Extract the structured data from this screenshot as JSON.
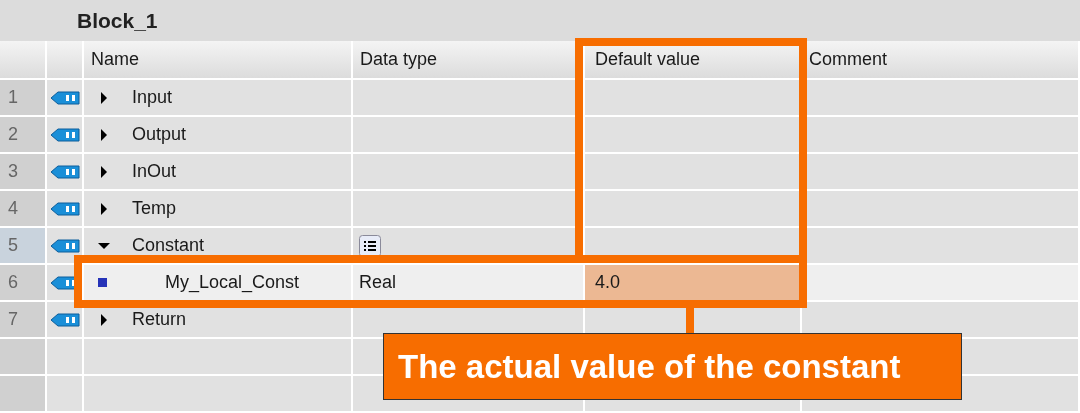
{
  "title": "Block_1",
  "columns": [
    "Name",
    "Data type",
    "Default value",
    "Comment"
  ],
  "rows": [
    {
      "number": "1",
      "kind": "section",
      "name": "Input",
      "expanded": false,
      "selected": false
    },
    {
      "number": "2",
      "kind": "section",
      "name": "Output",
      "expanded": false,
      "selected": false
    },
    {
      "number": "3",
      "kind": "section",
      "name": "InOut",
      "expanded": false,
      "selected": false
    },
    {
      "number": "4",
      "kind": "section",
      "name": "Temp",
      "expanded": false,
      "selected": false
    },
    {
      "number": "5",
      "kind": "section",
      "name": "Constant",
      "expanded": true,
      "selected": true
    },
    {
      "number": "6",
      "kind": "member",
      "name": "My_Local_Const",
      "data_type": "Real",
      "default_value": "4.0",
      "selected": false
    },
    {
      "number": "7",
      "kind": "section",
      "name": "Return",
      "expanded": false,
      "selected": false
    }
  ],
  "callout": {
    "text": "The actual value of the constant"
  }
}
